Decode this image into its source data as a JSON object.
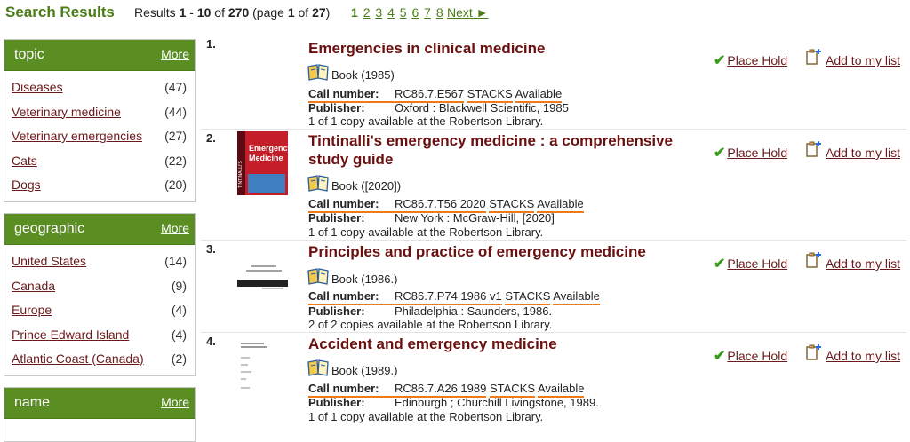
{
  "header": {
    "title": "Search Results",
    "results_prefix": "Results ",
    "range_start": "1",
    "range_sep": " - ",
    "range_end": "10",
    "of_text": " of ",
    "total": "270",
    "page_open": " (page ",
    "page": "1",
    "page_of": " of ",
    "page_total": "27",
    "page_close": ")",
    "pages": [
      "1",
      "2",
      "3",
      "4",
      "5",
      "6",
      "7",
      "8"
    ],
    "next": "Next ►"
  },
  "facets": [
    {
      "title": "topic",
      "more": "More",
      "items": [
        {
          "label": "Diseases",
          "count": "(47)"
        },
        {
          "label": "Veterinary medicine",
          "count": "(44)"
        },
        {
          "label": "Veterinary emergencies",
          "count": "(27)"
        },
        {
          "label": "Cats",
          "count": "(22)"
        },
        {
          "label": "Dogs",
          "count": "(20)"
        }
      ]
    },
    {
      "title": "geographic",
      "more": "More",
      "items": [
        {
          "label": "United States",
          "count": "(14)"
        },
        {
          "label": "Canada",
          "count": "(9)"
        },
        {
          "label": "Europe",
          "count": "(4)"
        },
        {
          "label": "Prince Edward Island",
          "count": "(4)"
        },
        {
          "label": "Atlantic Coast (Canada)",
          "count": "(2)"
        }
      ]
    },
    {
      "title": "name",
      "more": "More",
      "items": []
    }
  ],
  "labels": {
    "call_number": "Call number:",
    "publisher": "Publisher:",
    "place_hold": "Place Hold",
    "add_to_list": "Add to my list"
  },
  "results": [
    {
      "num": "1.",
      "title": "Emergencies in clinical medicine",
      "format": "Book (1985)",
      "call": "RC86.7.E567",
      "location": "STACKS",
      "status": "Available",
      "publisher": "Oxford : Blackwell Scientific, 1985",
      "availability": "1 of 1 copy available at the Robertson Library."
    },
    {
      "num": "2.",
      "title": "Tintinalli's emergency medicine : a comprehensive study guide",
      "format": "Book ([2020])",
      "call": "RC86.7.T56 2020",
      "location": "STACKS",
      "status": "Available",
      "publisher": "New York : McGraw-Hill, [2020]",
      "availability": "1 of 1 copy available at the Robertson Library.",
      "cover_text": [
        "TINTINALLI'S",
        "Emergency",
        "Medicine"
      ]
    },
    {
      "num": "3.",
      "title": "Principles and practice of emergency medicine",
      "format": "Book (1986.)",
      "call": "RC86.7.P74 1986 v1",
      "location": "STACKS",
      "status": "Available",
      "publisher": "Philadelphia : Saunders, 1986.",
      "availability": "2 of 2 copies available at the Robertson Library."
    },
    {
      "num": "4.",
      "title": "Accident and emergency medicine",
      "format": "Book (1989.)",
      "call": "RC86.7.A26 1989",
      "location": "STACKS",
      "status": "Available",
      "publisher": "Edinburgh ; Churchill Livingstone, 1989.",
      "availability": "1 of 1 copy available at the Robertson Library."
    }
  ],
  "colors": {
    "accent": "#5a8e22",
    "title": "#6b0f0f",
    "link": "#6a1a1a",
    "underline": "#f07a1a"
  }
}
